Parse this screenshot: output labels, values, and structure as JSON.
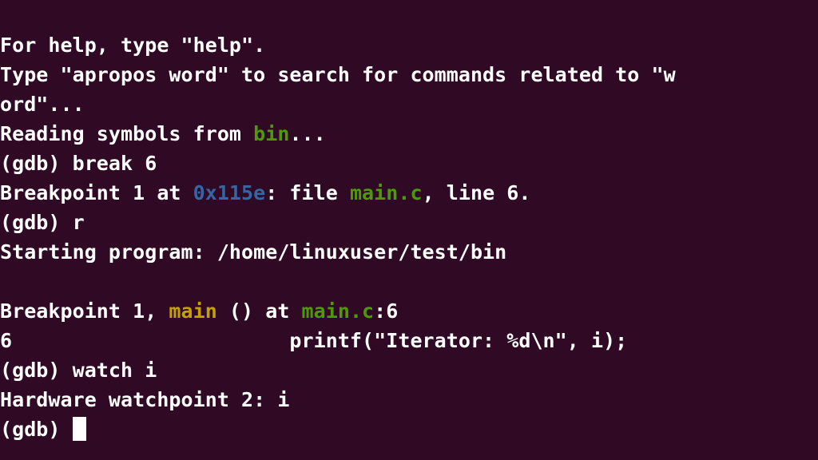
{
  "terminal": {
    "background_color": "#300a24",
    "foreground_color": "#ffffff",
    "green_color": "#4e9a06",
    "blue_color": "#3465a4",
    "yellow_color": "#c4a000",
    "cursor_color": "#ffffff",
    "columns": 59,
    "rows": 14
  },
  "lines": [
    {
      "id": "help-line",
      "segments": [
        {
          "text": "For help, type \"help\".",
          "color": "white"
        }
      ]
    },
    {
      "id": "apropos-line",
      "segments": [
        {
          "text": "Type \"apropos word\" to search for commands related to \"w",
          "color": "white"
        }
      ]
    },
    {
      "id": "apropos-wrap-line",
      "segments": [
        {
          "text": "ord\"...",
          "color": "white"
        }
      ]
    },
    {
      "id": "reading-symbols-line",
      "segments": [
        {
          "text": "Reading symbols from ",
          "color": "white"
        },
        {
          "text": "bin",
          "color": "green"
        },
        {
          "text": "...",
          "color": "white"
        }
      ]
    },
    {
      "id": "prompt-break-line",
      "segments": [
        {
          "text": "(gdb) break 6",
          "color": "white"
        }
      ]
    },
    {
      "id": "breakpoint-set-line",
      "segments": [
        {
          "text": "Breakpoint 1 at ",
          "color": "white"
        },
        {
          "text": "0x115e",
          "color": "blue"
        },
        {
          "text": ": file ",
          "color": "white"
        },
        {
          "text": "main.c",
          "color": "green"
        },
        {
          "text": ", line 6.",
          "color": "white"
        }
      ]
    },
    {
      "id": "prompt-run-line",
      "segments": [
        {
          "text": "(gdb) r",
          "color": "white"
        }
      ]
    },
    {
      "id": "starting-program-line",
      "segments": [
        {
          "text": "Starting program: /home/linuxuser/test/bin",
          "color": "white"
        }
      ]
    },
    {
      "id": "blank-line",
      "segments": [
        {
          "text": "",
          "color": "white"
        }
      ]
    },
    {
      "id": "breakpoint-hit-line",
      "segments": [
        {
          "text": "Breakpoint 1, ",
          "color": "white"
        },
        {
          "text": "main",
          "color": "yellow"
        },
        {
          "text": " () at ",
          "color": "white"
        },
        {
          "text": "main.c",
          "color": "green"
        },
        {
          "text": ":6",
          "color": "white"
        }
      ]
    },
    {
      "id": "source-line",
      "segments": [
        {
          "text": "6                       printf(\"Iterator: %d\\n\", i);",
          "color": "white"
        }
      ]
    },
    {
      "id": "prompt-watch-line",
      "segments": [
        {
          "text": "(gdb) watch i",
          "color": "white"
        }
      ]
    },
    {
      "id": "watchpoint-line",
      "segments": [
        {
          "text": "Hardware watchpoint 2: i",
          "color": "white"
        }
      ]
    },
    {
      "id": "prompt-active-line",
      "segments": [
        {
          "text": "(gdb) ",
          "color": "white"
        }
      ],
      "cursor": true
    }
  ]
}
